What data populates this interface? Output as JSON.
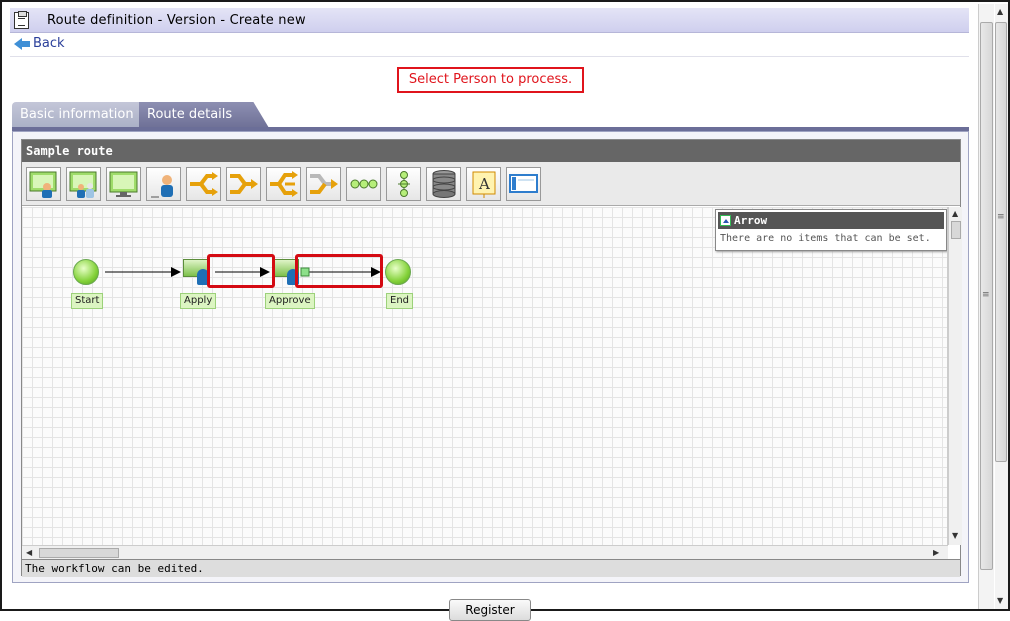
{
  "header": {
    "title": "Route definition - Version - Create new",
    "back_label": "Back"
  },
  "message": "Select Person to process.",
  "tabs": [
    {
      "label": "Basic information",
      "active": false
    },
    {
      "label": "Route details",
      "active": true
    }
  ],
  "route": {
    "name": "Sample route",
    "toolbar": [
      {
        "icon": "user-screen-icon"
      },
      {
        "icon": "user-screen-group-icon"
      },
      {
        "icon": "screen-icon"
      },
      {
        "icon": "person-icon"
      },
      {
        "icon": "branch-split-icon"
      },
      {
        "icon": "branch-merge-icon"
      },
      {
        "icon": "parallel-split-icon"
      },
      {
        "icon": "parallel-merge-icon"
      },
      {
        "icon": "horizontal-chain-icon"
      },
      {
        "icon": "vertical-chain-icon"
      },
      {
        "icon": "database-icon"
      },
      {
        "icon": "text-label-icon"
      },
      {
        "icon": "window-icon"
      }
    ],
    "nodes": [
      {
        "label": "Start",
        "kind": "start"
      },
      {
        "label": "Apply",
        "kind": "task"
      },
      {
        "label": "Approve",
        "kind": "task"
      },
      {
        "label": "End",
        "kind": "end"
      }
    ],
    "arrow_panel": {
      "title": "Arrow",
      "message": "There are no items that can be set."
    },
    "status": "The workflow can be edited."
  },
  "footer": {
    "register_label": "Register"
  },
  "colors": {
    "highlight": "#d40a12",
    "message": "#e0141c",
    "tab_active": "#6e7096",
    "node_green": "#84d23a"
  }
}
